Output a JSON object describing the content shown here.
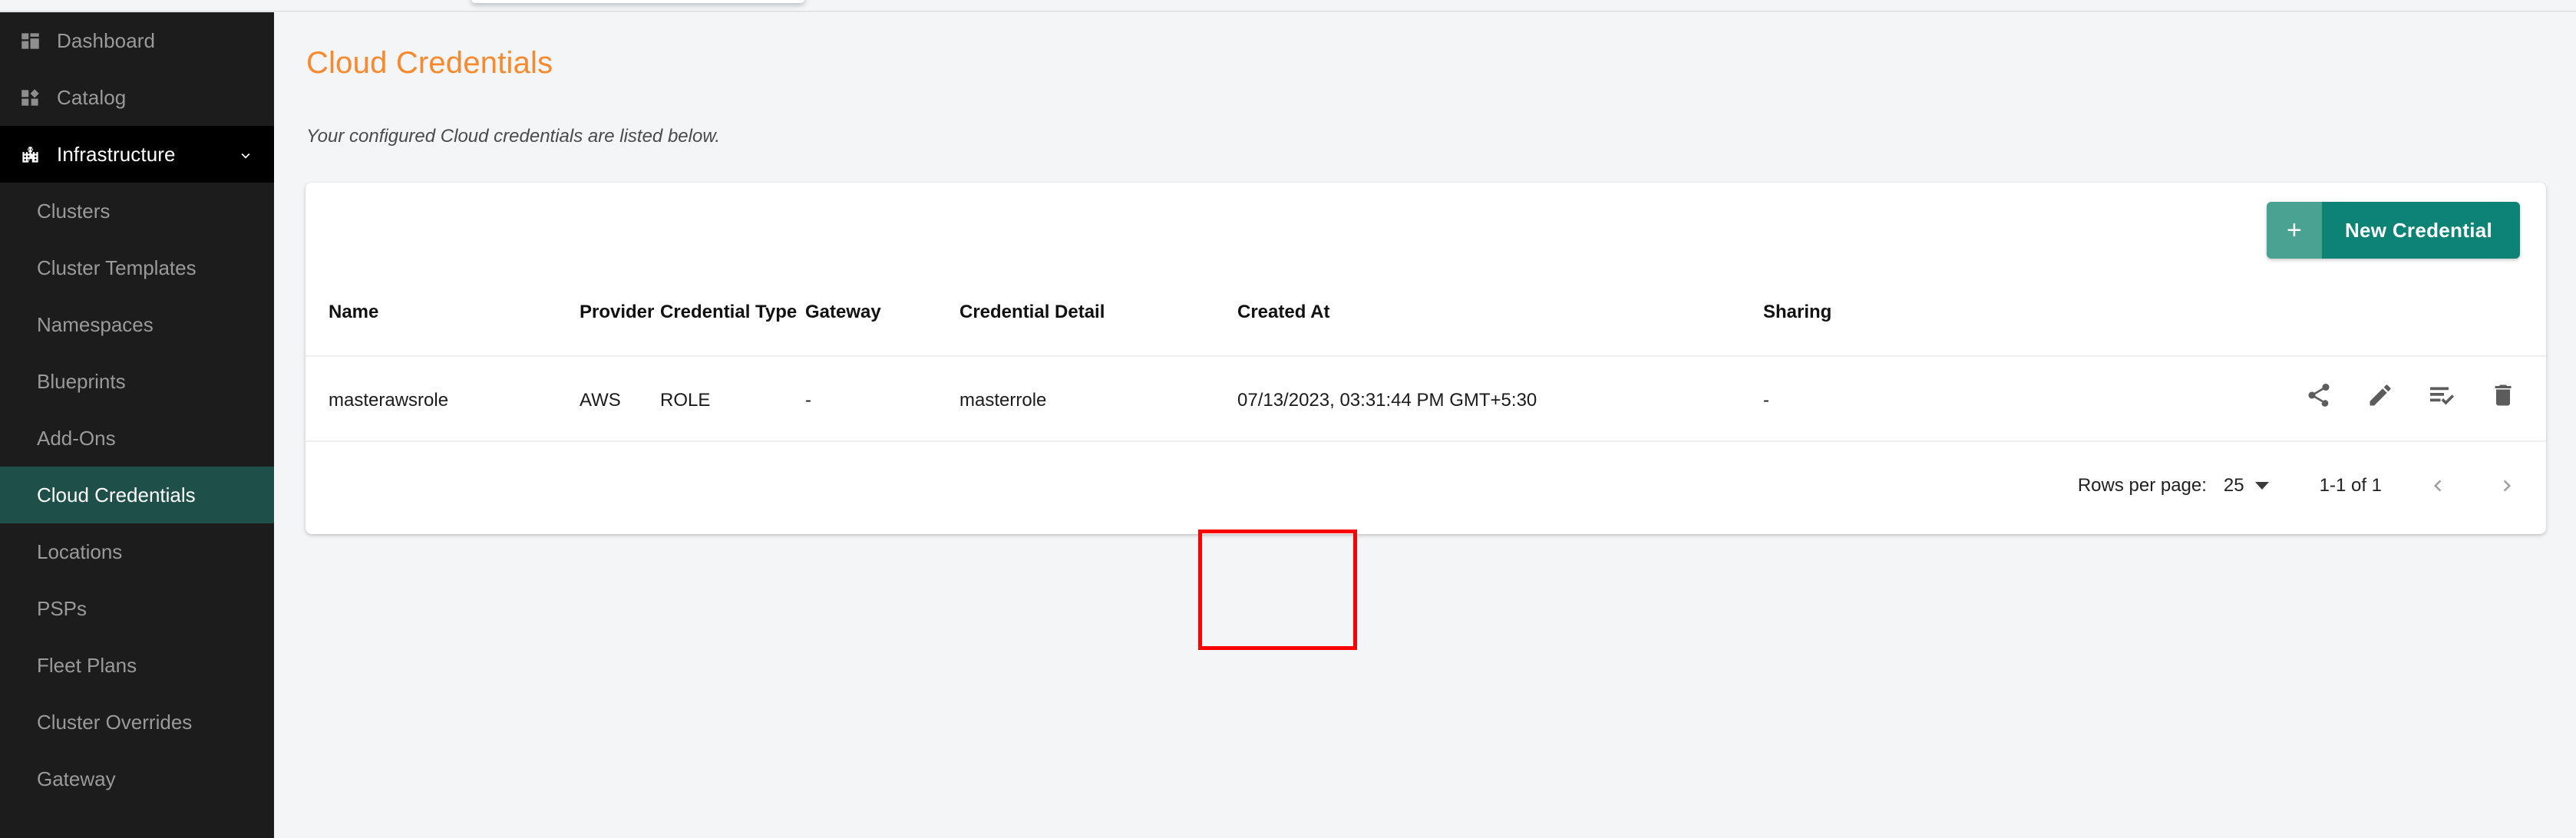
{
  "colors": {
    "accent_title": "#f8892c",
    "sidebar_bg": "#1c1c1c",
    "sidebar_active": "#1e5049",
    "button_primary": "#0c8375",
    "button_primary_light": "#4aa392",
    "highlight_box": "#fd0000"
  },
  "sidebar": {
    "top_items": [
      {
        "label": "Dashboard",
        "icon": "dashboard-grid-icon",
        "state": "default"
      },
      {
        "label": "Catalog",
        "icon": "catalog-grid-icon",
        "state": "default"
      },
      {
        "label": "Infrastructure",
        "icon": "building-icon",
        "state": "expanded",
        "chevron": "chevron-down-icon"
      }
    ],
    "sub_items": [
      {
        "label": "Clusters",
        "active": false
      },
      {
        "label": "Cluster Templates",
        "active": false
      },
      {
        "label": "Namespaces",
        "active": false
      },
      {
        "label": "Blueprints",
        "active": false
      },
      {
        "label": "Add-Ons",
        "active": false
      },
      {
        "label": "Cloud Credentials",
        "active": true
      },
      {
        "label": "Locations",
        "active": false
      },
      {
        "label": "PSPs",
        "active": false
      },
      {
        "label": "Fleet Plans",
        "active": false
      },
      {
        "label": "Cluster Overrides",
        "active": false
      },
      {
        "label": "Gateway",
        "active": false
      }
    ]
  },
  "page": {
    "title": "Cloud Credentials",
    "subtitle": "Your configured Cloud credentials are listed below."
  },
  "toolbar": {
    "new_credential_plus": "+",
    "new_credential_label": "New Credential"
  },
  "table": {
    "headers": {
      "name": "Name",
      "provider": "Provider",
      "credential_type": "Credential Type",
      "gateway": "Gateway",
      "credential_detail": "Credential Detail",
      "created_at": "Created At",
      "sharing": "Sharing"
    },
    "rows": [
      {
        "name": "masterawsrole",
        "provider": "AWS",
        "credential_type": "ROLE",
        "gateway": "-",
        "credential_detail": "masterrole",
        "created_at": "07/13/2023, 03:31:44 PM GMT+5:30",
        "sharing": "-"
      }
    ],
    "row_actions": [
      {
        "icon": "share-icon"
      },
      {
        "icon": "edit-pencil-icon"
      },
      {
        "icon": "list-check-icon"
      },
      {
        "icon": "delete-trash-icon"
      }
    ]
  },
  "pagination": {
    "rows_per_page_label": "Rows per page:",
    "rows_per_page_value": "25",
    "range_label": "1-1 of 1",
    "prev_icon": "chevron-left-icon",
    "next_icon": "chevron-right-icon"
  }
}
